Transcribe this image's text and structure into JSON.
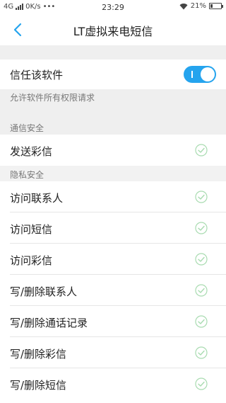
{
  "status_bar": {
    "network": "4G",
    "speed": "0K/s",
    "dots": "•••",
    "time": "23:29",
    "battery": "21%",
    "battery_level": 0.21
  },
  "header": {
    "title": "LT虚拟来电短信",
    "back_icon": "chevron-left-icon"
  },
  "trust": {
    "label": "信任该软件",
    "enabled": true,
    "accent_color": "#25a4ee",
    "note": "允许软件所有权限请求"
  },
  "sections": [
    {
      "title": "通信安全",
      "items": [
        {
          "label": "发送彩信",
          "granted": true
        }
      ]
    },
    {
      "title": "隐私安全",
      "items": [
        {
          "label": "访问联系人",
          "granted": true
        },
        {
          "label": "访问短信",
          "granted": true
        },
        {
          "label": "访问彩信",
          "granted": true
        },
        {
          "label": "写/删除联系人",
          "granted": true
        },
        {
          "label": "写/删除通话记录",
          "granted": true
        },
        {
          "label": "写/删除彩信",
          "granted": true
        },
        {
          "label": "写/删除短信",
          "granted": true
        }
      ]
    }
  ],
  "check_color": "#a8dbb0"
}
